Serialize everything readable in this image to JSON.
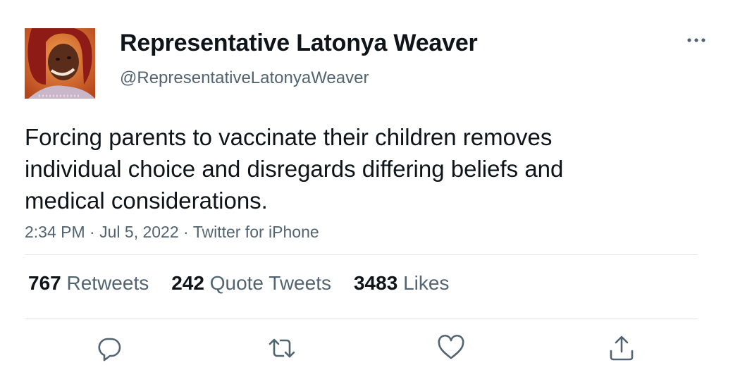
{
  "author": {
    "name": "Representative Latonya Weaver",
    "handle": "@RepresentativeLatonyaWeaver"
  },
  "tweet": {
    "text": "Forcing parents to vaccinate their children removes\nindividual choice and disregards differing beliefs and\nmedical considerations.",
    "time": "2:34 PM",
    "date": "Jul 5, 2022",
    "source": "Twitter for iPhone",
    "separator": "·"
  },
  "stats": {
    "retweets": {
      "count": "767",
      "label": "Retweets"
    },
    "quote_tweets": {
      "count": "242",
      "label": "Quote Tweets"
    },
    "likes": {
      "count": "3483",
      "label": "Likes"
    }
  },
  "icons": {
    "more": "more-dots-icon",
    "reply": "reply-icon",
    "retweet": "retweet-icon",
    "like": "heart-icon",
    "share": "share-icon"
  },
  "colors": {
    "text": "#0f1419",
    "secondary": "#536471",
    "divider": "#dfe3e6"
  }
}
